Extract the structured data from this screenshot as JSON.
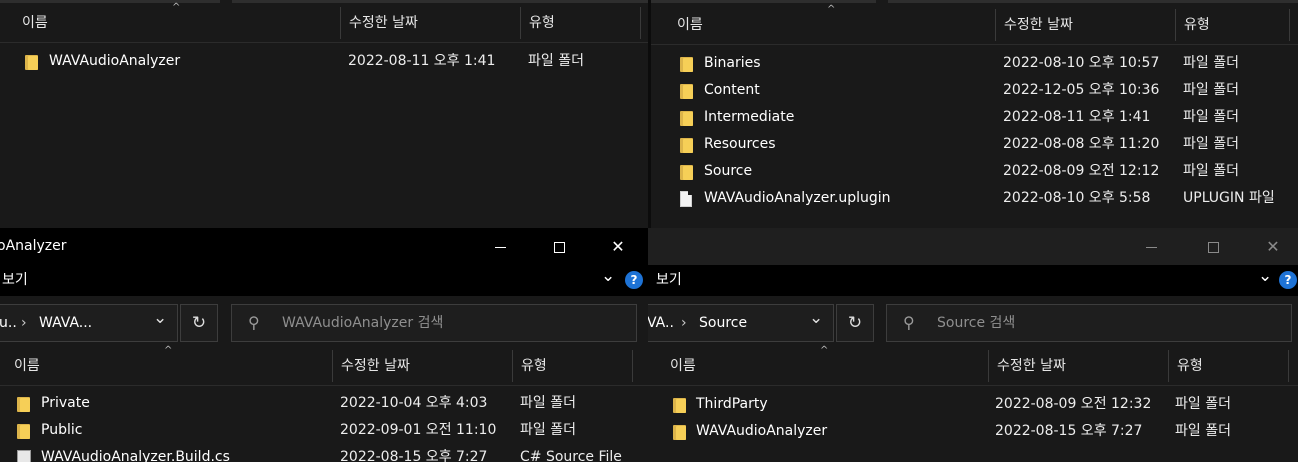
{
  "top_left": {
    "headers": {
      "name": "이름",
      "modified": "수정한 날짜",
      "type": "유형"
    },
    "rows": [
      {
        "name": "WAVAudioAnalyzer",
        "modified": "2022-08-11 오후 1:41",
        "type": "파일 폴더",
        "icon": "folder-icon"
      }
    ]
  },
  "top_right": {
    "headers": {
      "name": "이름",
      "modified": "수정한 날짜",
      "type": "유형"
    },
    "rows": [
      {
        "name": "Binaries",
        "modified": "2022-08-10 오후 10:57",
        "type": "파일 폴더",
        "icon": "folder-icon"
      },
      {
        "name": "Content",
        "modified": "2022-12-05 오후 10:36",
        "type": "파일 폴더",
        "icon": "folder-icon"
      },
      {
        "name": "Intermediate",
        "modified": "2022-08-11 오후 1:41",
        "type": "파일 폴더",
        "icon": "folder-icon"
      },
      {
        "name": "Resources",
        "modified": "2022-08-08 오후 11:20",
        "type": "파일 폴더",
        "icon": "folder-icon"
      },
      {
        "name": "Source",
        "modified": "2022-08-09 오전 12:12",
        "type": "파일 폴더",
        "icon": "folder-icon"
      },
      {
        "name": "WAVAudioAnalyzer.uplugin",
        "modified": "2022-08-10 오후 5:58",
        "type": "UPLUGIN 파일",
        "icon": "file-icon"
      }
    ]
  },
  "bottom_left": {
    "title": "oAnalyzer",
    "ribbon_label": "보기",
    "breadcrumb_prefix": "u..",
    "breadcrumb_current": "WAVA...",
    "search_placeholder": "WAVAudioAnalyzer 검색",
    "help": "?",
    "headers": {
      "name": "이름",
      "modified": "수정한 날짜",
      "type": "유형"
    },
    "rows": [
      {
        "name": "Private",
        "modified": "2022-10-04 오후 4:03",
        "type": "파일 폴더",
        "icon": "folder-icon"
      },
      {
        "name": "Public",
        "modified": "2022-09-01 오전 11:10",
        "type": "파일 폴더",
        "icon": "folder-icon"
      },
      {
        "name": "WAVAudioAnalyzer.Build.cs",
        "modified": "2022-08-15 오후 7:27",
        "type": "C# Source File",
        "icon": "csharp-file-icon"
      }
    ]
  },
  "bottom_right": {
    "ribbon_label": "보기",
    "breadcrumb_prefix": "VA..",
    "breadcrumb_current": "Source",
    "search_placeholder": "Source 검색",
    "help": "?",
    "headers": {
      "name": "이름",
      "modified": "수정한 날짜",
      "type": "유형"
    },
    "rows": [
      {
        "name": "ThirdParty",
        "modified": "2022-08-09 오전 12:32",
        "type": "파일 폴더",
        "icon": "folder-icon"
      },
      {
        "name": "WAVAudioAnalyzer",
        "modified": "2022-08-15 오후 7:27",
        "type": "파일 폴더",
        "icon": "folder-icon"
      }
    ]
  },
  "glyphs": {
    "chevron_right": "›",
    "chevron_down": "⌄",
    "refresh": "↻",
    "search": "⚲",
    "sort_up": "^",
    "minimize": "—",
    "maximize": "☐",
    "close": "✕"
  }
}
